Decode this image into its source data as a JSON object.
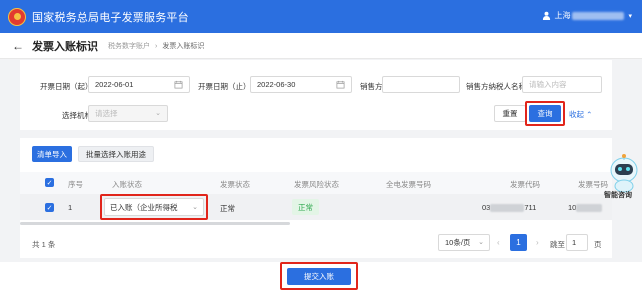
{
  "header": {
    "app_title": "国家税务总局电子发票服务平台",
    "user_prefix": "上海",
    "colors": {
      "brand": "#2b6fe0"
    }
  },
  "page": {
    "title": "发票入账标识",
    "breadcrumb": [
      "税务数字账户",
      "发票入账标识"
    ]
  },
  "filters": {
    "date_start_label": "开票日期（起）",
    "date_start_value": "2022-06-01",
    "date_end_label": "开票日期（止）",
    "date_end_value": "2022-06-30",
    "seller_tax_id_label": "销售方纳税人识...",
    "seller_name_label": "销售方纳税人名称",
    "seller_name_placeholder": "请输入内容",
    "org_label": "选择机构",
    "org_placeholder": "请选择",
    "reset_label": "重置",
    "query_label": "查询",
    "collapse_label": "收起"
  },
  "toolbar": {
    "import_label": "清单导入",
    "batch_label": "批量选择入账用途"
  },
  "table": {
    "columns": [
      "序号",
      "入账状态",
      "发票状态",
      "发票风险状态",
      "全电发票号码",
      "发票代码",
      "发票号码"
    ],
    "rows": [
      {
        "index": "1",
        "entry_status": "已入账（企业所得税",
        "invoice_status": "正常",
        "risk_status": "正常",
        "invoice_code_prefix": "03",
        "invoice_code_suffix": "711",
        "invoice_number_prefix": "10"
      }
    ]
  },
  "pagination": {
    "total": "共 1 条",
    "page_size": "10条/页",
    "current_page": "1",
    "jump_label": "跳至",
    "jump_value": "1",
    "page_suffix": "页"
  },
  "footer": {
    "submit_label": "提交入账"
  },
  "assistant": {
    "label": "智能咨询"
  }
}
